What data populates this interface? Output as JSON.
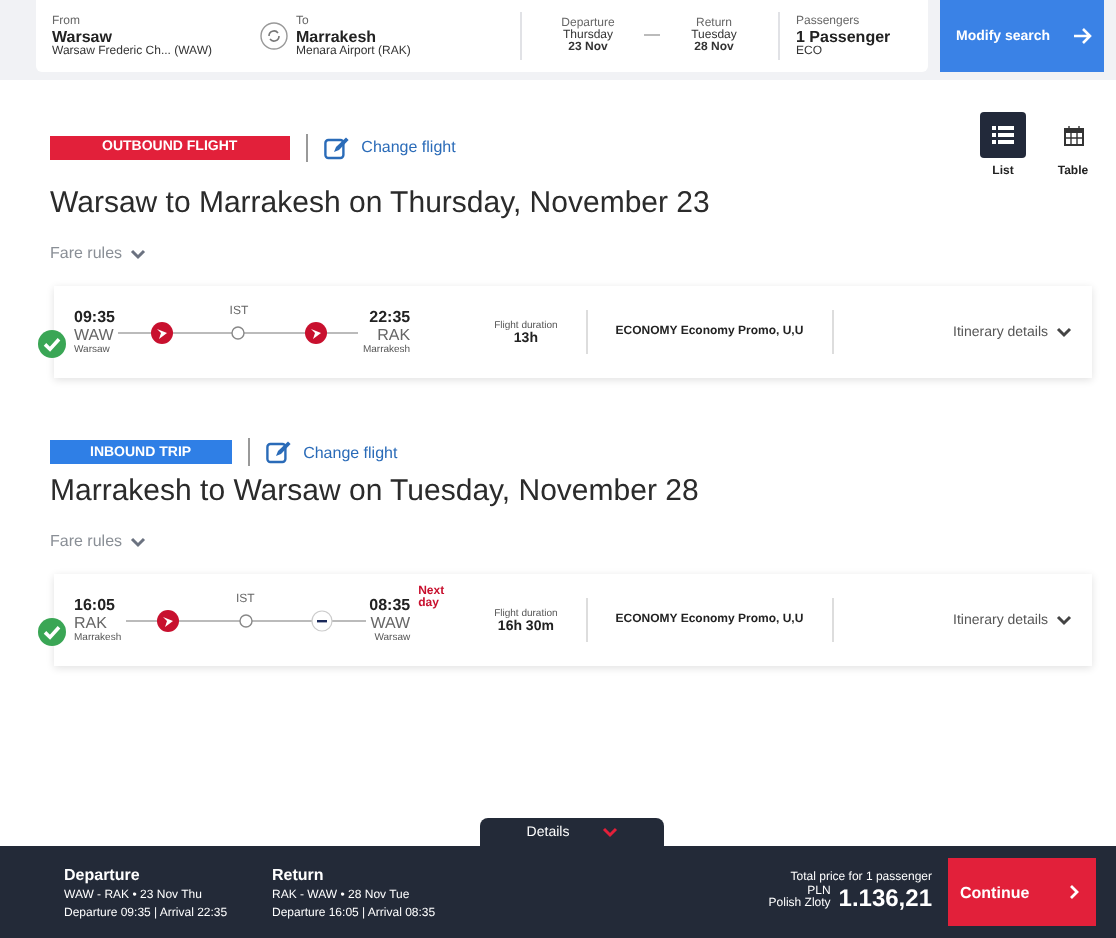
{
  "search": {
    "from": {
      "label": "From",
      "city": "Warsaw",
      "airport": "Warsaw Frederic Ch... (WAW)"
    },
    "to": {
      "label": "To",
      "city": "Marrakesh",
      "airport": "Menara Airport (RAK)"
    },
    "departure": {
      "label": "Departure",
      "day": "Thursday",
      "date": "23 Nov"
    },
    "return": {
      "label": "Return",
      "day": "Tuesday",
      "date": "28 Nov"
    },
    "passengers": {
      "label": "Passengers",
      "value": "1 Passenger",
      "cabin": "ECO"
    },
    "button": "Modify search"
  },
  "views": [
    {
      "label": "List",
      "selected": true
    },
    {
      "label": "Table",
      "selected": false
    }
  ],
  "flights": [
    {
      "kind": "outbound",
      "badge": "OUTBOUND FLIGHT",
      "change": "Change flight",
      "title": "Warsaw to Marrakesh on Thursday, November 23",
      "fare_rules": "Fare rules",
      "selected": true,
      "dep_time": "09:35",
      "dep_code": "WAW",
      "dep_city": "Warsaw",
      "stop": "IST",
      "arr_time": "22:35",
      "arr_code": "RAK",
      "arr_city": "Marrakesh",
      "duration_label": "Flight duration",
      "duration": "13h",
      "fare": "ECONOMY Economy Promo, U,U",
      "details": "Itinerary details",
      "carriers": [
        {
          "kind": "tail"
        },
        {
          "kind": "tail"
        }
      ]
    },
    {
      "kind": "inbound",
      "badge": "INBOUND TRIP",
      "change": "Change flight",
      "title": "Marrakesh to Warsaw on Tuesday, November 28",
      "fare_rules": "Fare rules",
      "selected": true,
      "dep_time": "16:05",
      "dep_code": "RAK",
      "dep_city": "Marrakesh",
      "stop": "IST",
      "arr_time": "08:35",
      "arr_code": "WAW",
      "arr_city": "Warsaw",
      "next_day": "Next day",
      "duration_label": "Flight duration",
      "duration": "16h 30m",
      "fare": "ECONOMY Economy Promo, U,U",
      "details": "Itinerary details",
      "carriers": [
        {
          "kind": "tail"
        },
        {
          "kind": "badge"
        }
      ]
    }
  ],
  "footer": {
    "tab": "Details",
    "legs": [
      {
        "title": "Departure",
        "route": "WAW - RAK",
        "separator": "•",
        "date": "23 Nov Thu",
        "times": "Departure 09:35 | Arrival 22:35"
      },
      {
        "title": "Return",
        "route": "RAK - WAW",
        "separator": "•",
        "date": "28 Nov Tue",
        "times": "Departure 16:05 | Arrival 08:35"
      }
    ],
    "total_label": "Total price for 1 passenger",
    "currency": "PLN",
    "currency_name": "Polish Zloty",
    "price": "1.136,21",
    "button": "Continue"
  }
}
